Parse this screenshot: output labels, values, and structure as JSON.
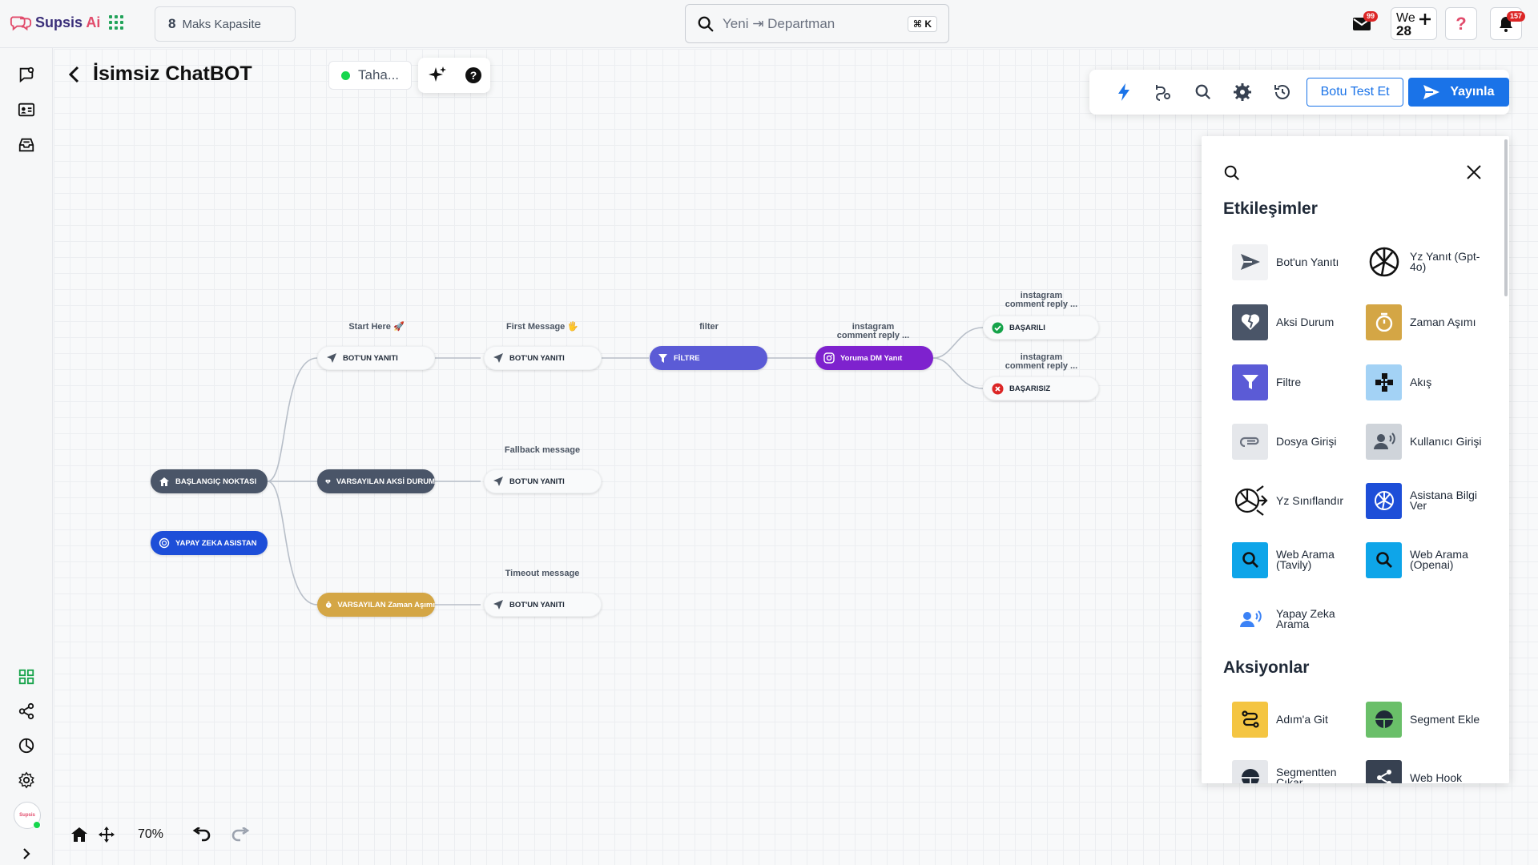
{
  "topbar": {
    "logo_text": "Supsis",
    "logo_ai": "Ai",
    "capacity_number": "8",
    "capacity_label": "Maks Kapasite",
    "search_placeholder": "Yeni ⇥ Departman",
    "search_shortcut": "⌘ K",
    "mail_badge": "99",
    "we_label": "We",
    "we_number": "28",
    "notif_badge": "157"
  },
  "editor": {
    "title": "İsimsiz ChatBOT",
    "assignee": "Taha...",
    "test_button": "Botu Test Et",
    "publish_button": "Yayınla",
    "zoom": "70%"
  },
  "flow": {
    "nodes": {
      "start": "BAŞLANGIÇ NOKTASI",
      "ai_assistant": "YAPAY ZEKA ASISTAN",
      "bot_reply_1": "BOT'UN YANITI",
      "bot_reply_2": "BOT'UN YANITI",
      "filter": "FİLTRE",
      "insta_dm": "Yoruma DM Yanıt",
      "success": "BAŞARILI",
      "fail": "BAŞARISIZ",
      "default_fallback": "VARSAYILAN AKSİ DURUM",
      "bot_reply_3": "BOT'UN YANITI",
      "default_timeout": "VARSAYILAN Zaman Aşımı",
      "bot_reply_4": "BOT'UN YANITI"
    },
    "labels": {
      "start_here": "Start Here 🚀",
      "first_message": "First Message 🖐",
      "filter": "filter",
      "insta_comment_1": "instagram",
      "insta_comment_1b": "comment reply ...",
      "insta_comment_2": "instagram",
      "insta_comment_2b": "comment reply ...",
      "insta_comment_3": "instagram",
      "insta_comment_3b": "comment reply ...",
      "fallback": "Fallback message",
      "timeout": "Timeout message"
    }
  },
  "panel": {
    "section_interactions": "Etkileşimler",
    "section_actions": "Aksiyonlar",
    "interactions": [
      {
        "label": "Bot'un Yanıtı",
        "icon": "send-icon"
      },
      {
        "label": "Yz Yanıt (Gpt-4o)",
        "icon": "openai-icon"
      },
      {
        "label": "Aksi Durum",
        "icon": "broken-heart-icon"
      },
      {
        "label": "Zaman Aşımı",
        "icon": "timer-icon"
      },
      {
        "label": "Filtre",
        "icon": "filter-icon"
      },
      {
        "label": "Akış",
        "icon": "flow-icon"
      },
      {
        "label": "Dosya Girişi",
        "icon": "paperclip-icon"
      },
      {
        "label": "Kullanıcı Girişi",
        "icon": "user-voice-icon"
      },
      {
        "label": "Yz Sınıflandır",
        "icon": "ai-classify-icon"
      },
      {
        "label": "Asistana Bilgi Ver",
        "icon": "openai-icon"
      },
      {
        "label": "Web Arama (Tavily)",
        "icon": "search-icon"
      },
      {
        "label": "Web Arama (Openai)",
        "icon": "search-icon"
      },
      {
        "label": "Yapay Zeka Arama",
        "icon": "ai-voice-icon"
      }
    ],
    "actions": [
      {
        "label": "Adım'a Git",
        "icon": "route-icon"
      },
      {
        "label": "Segment Ekle",
        "icon": "segment-icon"
      },
      {
        "label": "Segmentten Çıkar",
        "icon": "segment-icon"
      },
      {
        "label": "Web Hook",
        "icon": "share-icon"
      }
    ]
  },
  "colors": {
    "accent": "#1a73e8",
    "brand": "#e14b6b",
    "success": "#16a34a",
    "danger": "#dc2626"
  }
}
